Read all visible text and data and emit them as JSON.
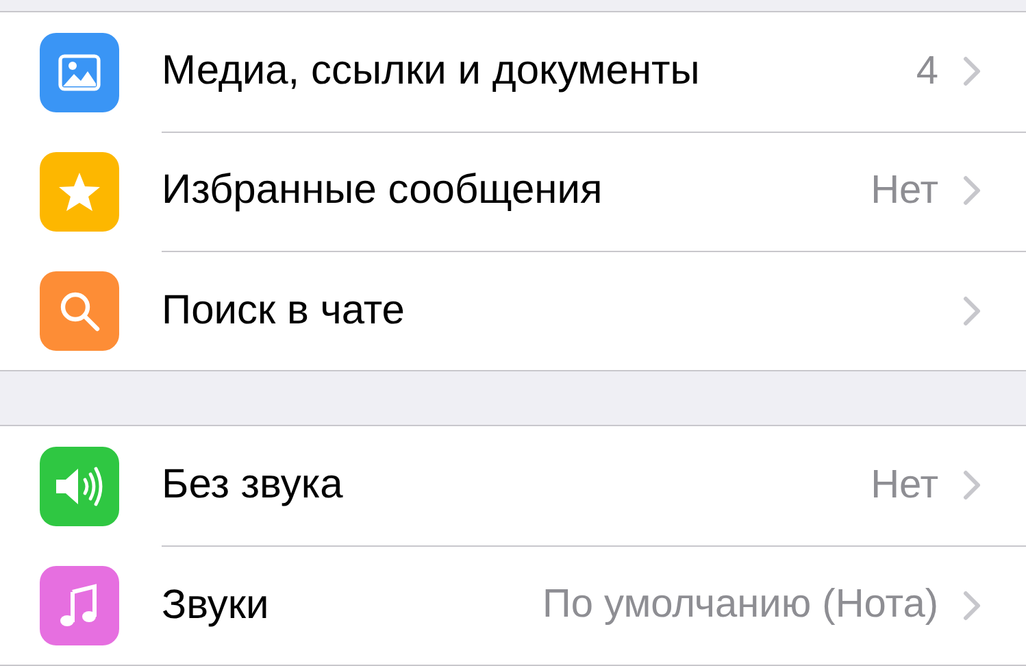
{
  "sections": [
    {
      "rows": [
        {
          "kind": "media",
          "color": "#3a95f5",
          "label": "Медиа, ссылки и документы",
          "value": "4"
        },
        {
          "kind": "star",
          "color": "#fdb700",
          "label": "Избранные сообщения",
          "value": "Нет"
        },
        {
          "kind": "search",
          "color": "#fd8d36",
          "label": "Поиск в чате"
        }
      ]
    },
    {
      "rows": [
        {
          "kind": "speaker",
          "color": "#2fc742",
          "label": "Без звука",
          "value": "Нет"
        },
        {
          "kind": "music",
          "color": "#e66fe0",
          "label": "Звуки",
          "value": "По умолчанию (Нота)"
        }
      ]
    }
  ]
}
